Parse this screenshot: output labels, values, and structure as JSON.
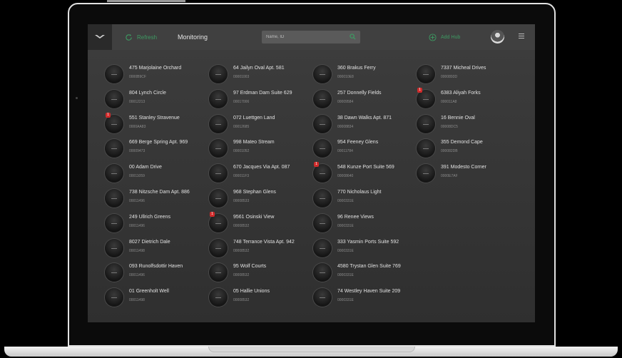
{
  "header": {
    "refresh_label": "Refresh",
    "title": "Monitoring",
    "search_placeholder": "Name, ID",
    "add_hub_label": "Add Hub",
    "accent_color": "#3d9a62"
  },
  "hubs": [
    {
      "name": "475 Marjolaine Orchard",
      "id": "0000B9CF",
      "badge": ""
    },
    {
      "name": "804 Lynch Circle",
      "id": "00012213",
      "badge": ""
    },
    {
      "name": "551 Stanley Stravenue",
      "id": "0000AA83",
      "badge": "1"
    },
    {
      "name": "669 Berge Spring Apt. 969",
      "id": "00009473",
      "badge": ""
    },
    {
      "name": "00 Adam Drive",
      "id": "00011059",
      "badge": ""
    },
    {
      "name": "738 Nitzsche Dam Apt. 886",
      "id": "00011496",
      "badge": ""
    },
    {
      "name": "249 Ullrich Greens",
      "id": "00011496",
      "badge": ""
    },
    {
      "name": "8027 Dietrich Dale",
      "id": "00011498",
      "badge": ""
    },
    {
      "name": "093 Runolfsdottir Haven",
      "id": "00011496",
      "badge": ""
    },
    {
      "name": "01 Greenholt Well",
      "id": "00011498",
      "badge": ""
    },
    {
      "name": "64 Jailyn Oval Apt. 581",
      "id": "00001003",
      "badge": ""
    },
    {
      "name": "97 Erdman Dam Suite 629",
      "id": "00017006",
      "badge": ""
    },
    {
      "name": "072 Luettgen Land",
      "id": "00012685",
      "badge": ""
    },
    {
      "name": "998 Mateo Stream",
      "id": "00001052",
      "badge": ""
    },
    {
      "name": "670 Jacques Via Apt. 087",
      "id": "000011F3",
      "badge": ""
    },
    {
      "name": "968 Stephan Glens",
      "id": "00008533",
      "badge": ""
    },
    {
      "name": "9561 Osinski View",
      "id": "00008532",
      "badge": "1"
    },
    {
      "name": "748 Terrance Vista Apt. 942",
      "id": "00008532",
      "badge": ""
    },
    {
      "name": "95 Wolf Courts",
      "id": "00008532",
      "badge": ""
    },
    {
      "name": "05 Hallie Unions",
      "id": "00008532",
      "badge": ""
    },
    {
      "name": "360 Brakus Ferry",
      "id": "000010E8",
      "badge": ""
    },
    {
      "name": "257 Donnelly Fields",
      "id": "00009584",
      "badge": ""
    },
    {
      "name": "38 Dawn Walks Apt. 871",
      "id": "00008834",
      "badge": ""
    },
    {
      "name": "954 Feeney Glens",
      "id": "00011784",
      "badge": ""
    },
    {
      "name": "548 Kunze Port Suite 569",
      "id": "00008640",
      "badge": "1"
    },
    {
      "name": "770 Nicholaus Light",
      "id": "0000331E",
      "badge": ""
    },
    {
      "name": "96 Renee Views",
      "id": "0000331E",
      "badge": ""
    },
    {
      "name": "333 Yasmin Ports Suite 592",
      "id": "0000331E",
      "badge": ""
    },
    {
      "name": "4580 Trystan Glen Suite 769",
      "id": "0000331E",
      "badge": ""
    },
    {
      "name": "74 Westley Haven Suite 209",
      "id": "0000331E",
      "badge": ""
    },
    {
      "name": "7337 Micheal Drives",
      "id": "0000893D",
      "badge": ""
    },
    {
      "name": "6383 Aliyah Forks",
      "id": "000011A8",
      "badge": "1"
    },
    {
      "name": "16 Bennie Oval",
      "id": "00008DC5",
      "badge": ""
    },
    {
      "name": "355 Demond Cape",
      "id": "000082DB",
      "badge": ""
    },
    {
      "name": "391 Modesto Corner",
      "id": "0000E7AF",
      "badge": ""
    }
  ]
}
